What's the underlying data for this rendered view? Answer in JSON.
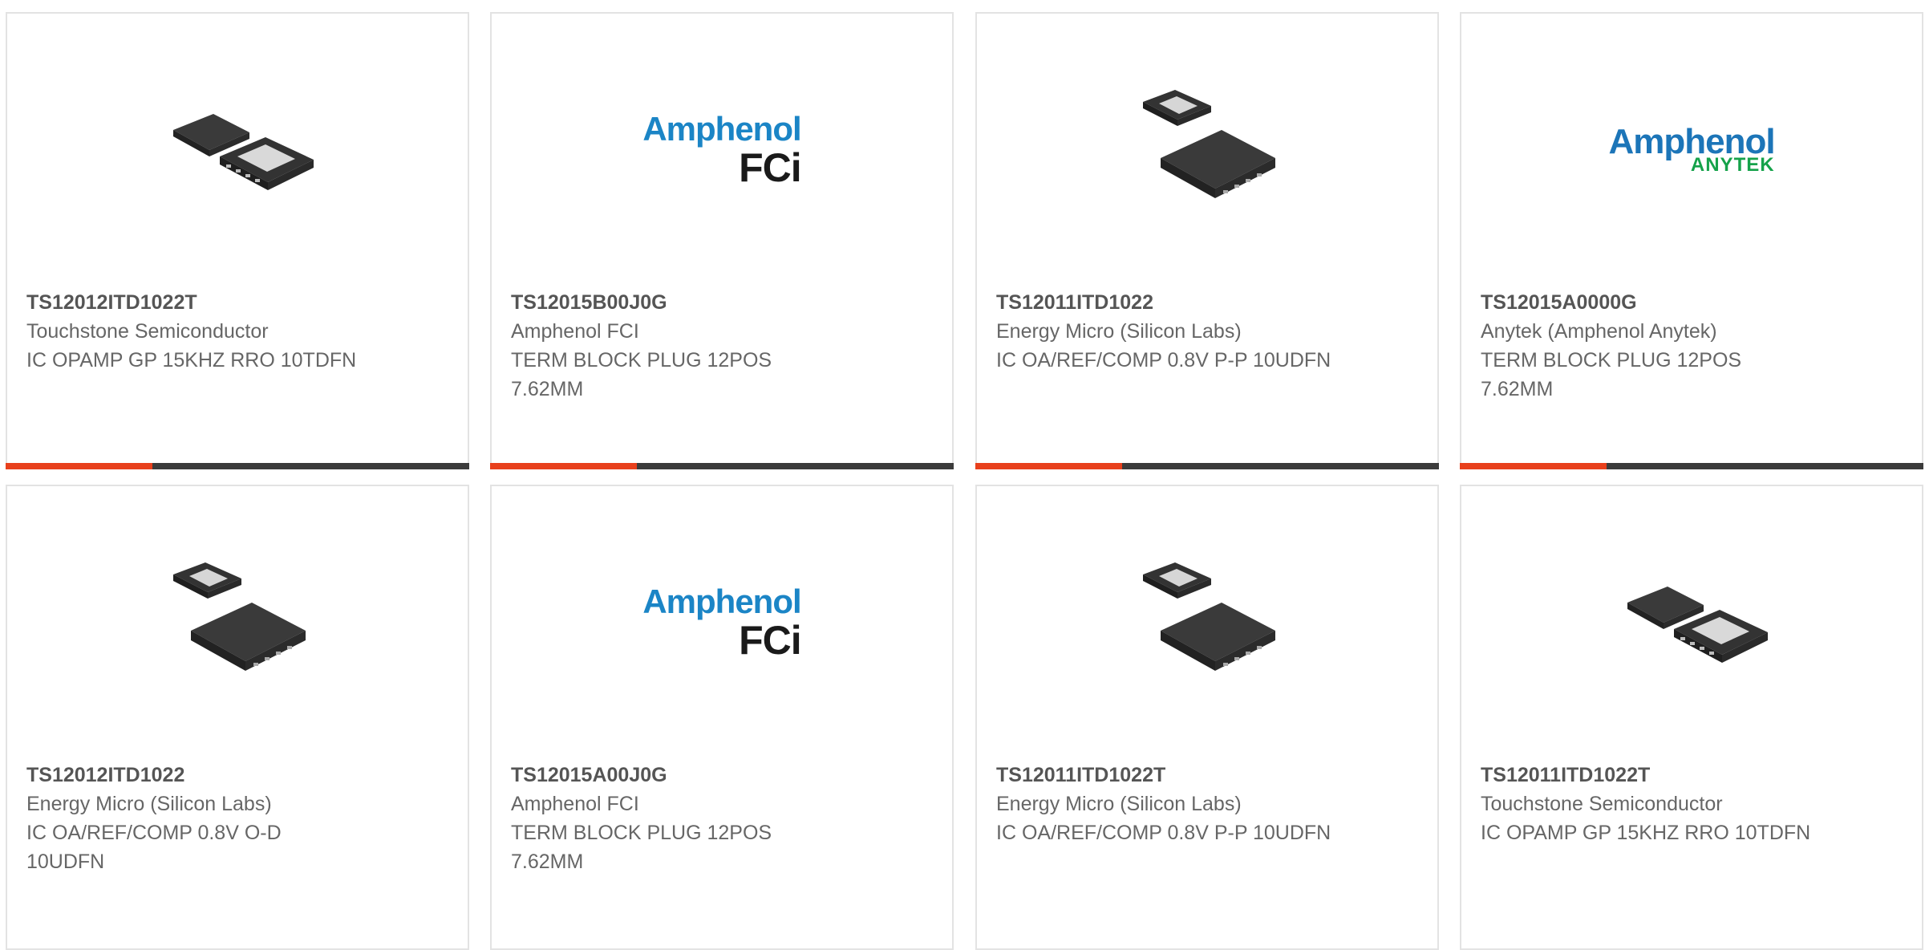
{
  "products": [
    {
      "part_number": "TS12012ITD1022T",
      "manufacturer": "Touchstone Semiconductor",
      "description": "IC OPAMP GP 15KHZ RRO 10TDFN",
      "image": "chip-pair-icon"
    },
    {
      "part_number": "TS12015B00J0G",
      "manufacturer": "Amphenol FCI",
      "description": "TERM BLOCK PLUG 12POS 7.62MM",
      "image": "logo",
      "logo": {
        "main": "Amphenol",
        "sub": "FCi"
      }
    },
    {
      "part_number": "TS12011ITD1022",
      "manufacturer": "Energy Micro (Silicon Labs)",
      "description": "IC OA/REF/COMP 0.8V P-P 10UDFN",
      "image": "chip-stack-icon"
    },
    {
      "part_number": "TS12015A0000G",
      "manufacturer": "Anytek (Amphenol Anytek)",
      "description": "TERM BLOCK PLUG 12POS 7.62MM",
      "image": "logo",
      "logo": {
        "main": "Amphenol",
        "sub": "ANYTEK"
      }
    },
    {
      "part_number": "TS12012ITD1022",
      "manufacturer": "Energy Micro (Silicon Labs)",
      "description": "IC OA/REF/COMP 0.8V O-D 10UDFN",
      "image": "chip-stack-icon"
    },
    {
      "part_number": "TS12015A00J0G",
      "manufacturer": "Amphenol FCI",
      "description": "TERM BLOCK PLUG 12POS 7.62MM",
      "image": "logo",
      "logo": {
        "main": "Amphenol",
        "sub": "FCi"
      }
    },
    {
      "part_number": "TS12011ITD1022T",
      "manufacturer": "Energy Micro (Silicon Labs)",
      "description": "IC OA/REF/COMP 0.8V P-P 10UDFN",
      "image": "chip-stack-icon"
    },
    {
      "part_number": "TS12011ITD1022T",
      "manufacturer": "Touchstone Semiconductor",
      "description": "IC OPAMP GP 15KHZ RRO 10TDFN",
      "image": "chip-pair-icon"
    }
  ],
  "colors": {
    "accent": "#e8401c",
    "bar": "#3b3b3b",
    "border": "#e3e3e3"
  }
}
